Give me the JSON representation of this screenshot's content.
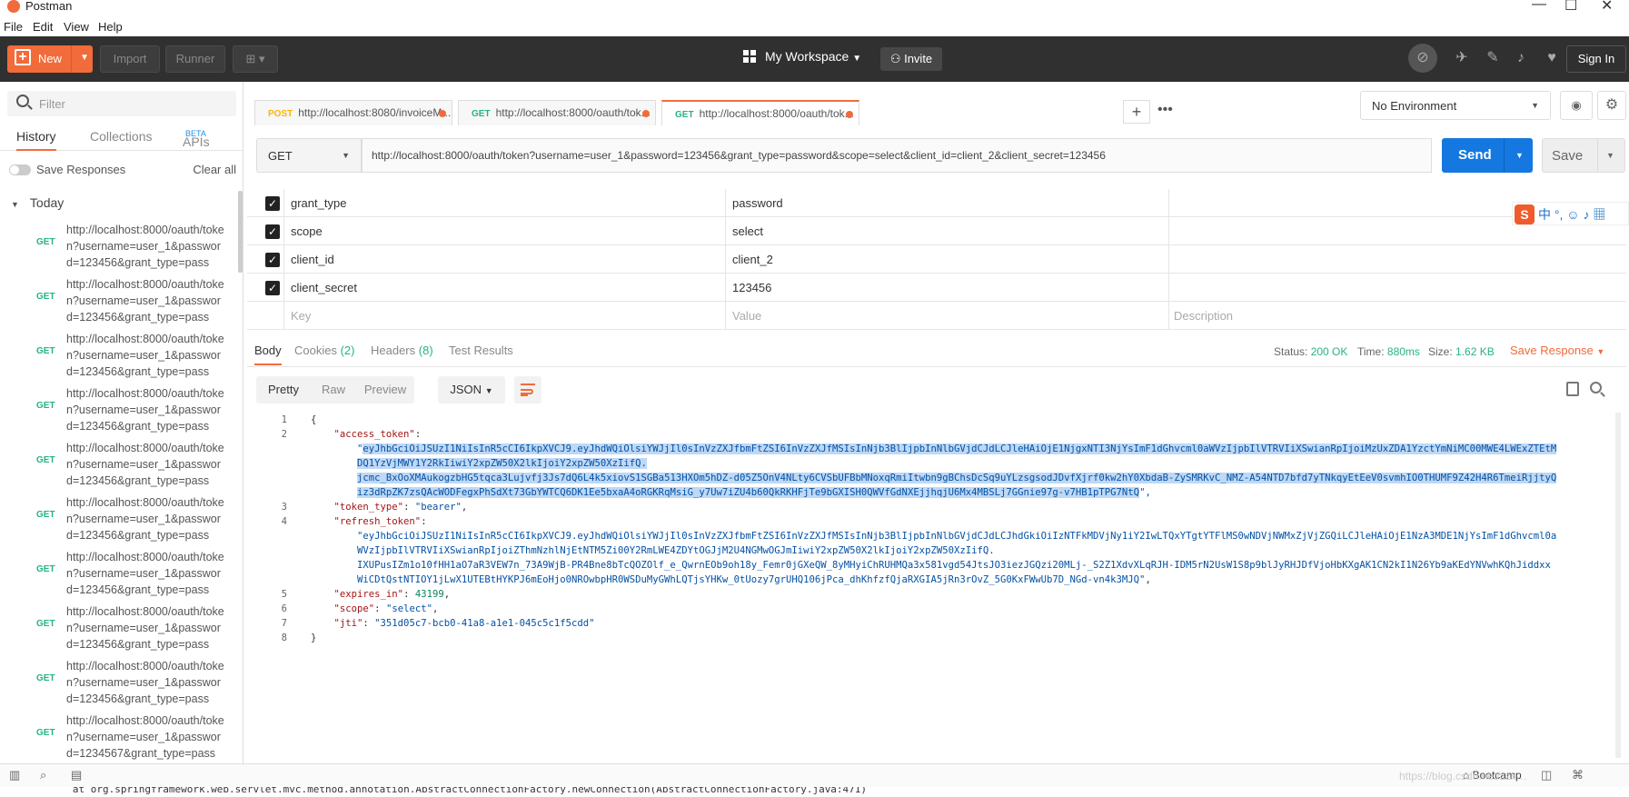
{
  "window": {
    "title": "Postman",
    "minimize": "—",
    "maximize": "☐",
    "close": "✕"
  },
  "menu": [
    "File",
    "Edit",
    "View",
    "Help"
  ],
  "header": {
    "new_label": "New",
    "import_label": "Import",
    "runner_label": "Runner",
    "workspace_label": "My Workspace",
    "invite_label": "Invite",
    "signin_label": "Sign In"
  },
  "sidebar": {
    "filter_placeholder": "Filter",
    "tabs": [
      "History",
      "Collections",
      "APIs"
    ],
    "apis_badge": "BETA",
    "save_responses": "Save Responses",
    "clear_all": "Clear all",
    "group": "Today",
    "items": [
      {
        "method": "GET",
        "url": "http://localhost:8000/oauth/token?username=user_1&password=123456&grant_type=pass"
      },
      {
        "method": "GET",
        "url": "http://localhost:8000/oauth/token?username=user_1&password=123456&grant_type=pass"
      },
      {
        "method": "GET",
        "url": "http://localhost:8000/oauth/token?username=user_1&password=123456&grant_type=pass"
      },
      {
        "method": "GET",
        "url": "http://localhost:8000/oauth/token?username=user_1&password=123456&grant_type=pass"
      },
      {
        "method": "GET",
        "url": "http://localhost:8000/oauth/token?username=user_1&password=123456&grant_type=pass"
      },
      {
        "method": "GET",
        "url": "http://localhost:8000/oauth/token?username=user_1&password=123456&grant_type=pass"
      },
      {
        "method": "GET",
        "url": "http://localhost:8000/oauth/token?username=user_1&password=123456&grant_type=pass"
      },
      {
        "method": "GET",
        "url": "http://localhost:8000/oauth/token?username=user_1&password=123456&grant_type=pass"
      },
      {
        "method": "GET",
        "url": "http://localhost:8000/oauth/token?username=user_1&password=123456&grant_type=pass"
      },
      {
        "method": "GET",
        "url": "http://localhost:8000/oauth/token?username=user_1&password=1234567&grant_type=pass"
      }
    ]
  },
  "tabs": [
    {
      "method": "POST",
      "label": "http://localhost:8080/invoiceM...",
      "color": "#ffb400"
    },
    {
      "method": "GET",
      "label": "http://localhost:8000/oauth/tok...",
      "color": "#26b47f"
    },
    {
      "method": "GET",
      "label": "http://localhost:8000/oauth/tok...",
      "color": "#26b47f"
    }
  ],
  "environment": {
    "selected": "No Environment"
  },
  "request": {
    "method": "GET",
    "url": "http://localhost:8000/oauth/token?username=user_1&password=123456&grant_type=password&scope=select&client_id=client_2&client_secret=123456",
    "send_label": "Send",
    "save_label": "Save"
  },
  "params": [
    {
      "key": "grant_type",
      "value": "password"
    },
    {
      "key": "scope",
      "value": "select"
    },
    {
      "key": "client_id",
      "value": "client_2"
    },
    {
      "key": "client_secret",
      "value": "123456"
    }
  ],
  "params_placeholder": {
    "key": "Key",
    "value": "Value",
    "description": "Description"
  },
  "ime": {
    "logo": "S",
    "text": "中 °, ☺ ♪ ▦"
  },
  "response": {
    "tabs": {
      "body": "Body",
      "cookies": "Cookies",
      "cookies_count": "(2)",
      "headers": "Headers",
      "headers_count": "(8)",
      "tests": "Test Results"
    },
    "status_label": "Status:",
    "status": "200 OK",
    "time_label": "Time:",
    "time": "880ms",
    "size_label": "Size:",
    "size": "1.62 KB",
    "save_response": "Save Response",
    "views": [
      "Pretty",
      "Raw",
      "Preview"
    ],
    "format": "JSON"
  },
  "code_lines": [
    {
      "n": "1",
      "parts": [
        {
          "t": "{",
          "c": ""
        }
      ]
    },
    {
      "n": "2",
      "parts": [
        {
          "t": "    \"access_token\"",
          "c": "key"
        },
        {
          "t": ":",
          "c": ""
        }
      ]
    },
    {
      "n": "",
      "parts": [
        {
          "t": "        \"",
          "c": "str"
        },
        {
          "t": "eyJhbGciOiJSUzI1NiIsInR5cCI6IkpXVCJ9.eyJhdWQiOlsiYWJjIl0sInVzZXJfbmFtZSI6InVzZXJfMSIsInNjb3BlIjpbInNlbGVjdCJdLCJleHAiOjE1NjgxNTI3NjYsImF1dGhvcml0aWVzIjpbIlVTRVIiXSwianRpIjoiMzUxZDA1YzctYmNiMC00MWE4LWExZTEtM",
          "c": "str sel"
        }
      ]
    },
    {
      "n": "",
      "parts": [
        {
          "t": "        ",
          "c": ""
        },
        {
          "t": "DQ1YzVjMWY1Y2RkIiwiY2xpZW50X2lkIjoiY2xpZW50XzIifQ.",
          "c": "str sel"
        }
      ]
    },
    {
      "n": "",
      "parts": [
        {
          "t": "        ",
          "c": ""
        },
        {
          "t": "jcmc_BxOoXMAukogzbHG5tqca3Lujvfj3Js7dQ6L4k5xiovS1SGBa513HXOm5hDZ-d05Z5OnV4NLty6CVSbUFBbMNoxqRmiItwbn9gBChsDcSq9uYLzsgsodJDvfXjrf0kw2hY0XbdaB-ZySMRKvC_NMZ-A54NTD7bfd7yTNkqyEtEeV0svmhIO0THUMF9Z42H4R6TmeiRjjtyQ",
          "c": "str sel"
        }
      ]
    },
    {
      "n": "",
      "parts": [
        {
          "t": "        ",
          "c": ""
        },
        {
          "t": "iz3dRpZK7zsQAcWODFegxPhSdXt73GbYWTCQ6DK1Ee5bxaA4oRGKRqMsiG_y7Uw7iZU4b60QkRKHFjTe9bGXISH0QWVfGdNXEjjhqjU6Mx4MBSLj7GGnie97g-v7HB1pTPG7NtQ",
          "c": "str sel"
        },
        {
          "t": "\",",
          "c": "str"
        }
      ]
    },
    {
      "n": "3",
      "parts": [
        {
          "t": "    \"token_type\"",
          "c": "key"
        },
        {
          "t": ": ",
          "c": ""
        },
        {
          "t": "\"bearer\"",
          "c": "str"
        },
        {
          "t": ",",
          "c": ""
        }
      ]
    },
    {
      "n": "4",
      "parts": [
        {
          "t": "    \"refresh_token\"",
          "c": "key"
        },
        {
          "t": ":",
          "c": ""
        }
      ]
    },
    {
      "n": "",
      "parts": [
        {
          "t": "        \"eyJhbGciOiJSUzI1NiIsInR5cCI6IkpXVCJ9.eyJhdWQiOlsiYWJjIl0sInVzZXJfbmFtZSI6InVzZXJfMSIsInNjb3BlIjpbInNlbGVjdCJdLCJhdGkiOiIzNTFkMDVjNy1iY2IwLTQxYTgtYTFlMS0wNDVjNWMxZjVjZGQiLCJleHAiOjE1NzA3MDE1NjYsImF1dGhvcml0a",
          "c": "str"
        }
      ]
    },
    {
      "n": "",
      "parts": [
        {
          "t": "        WVzIjpbIlVTRVIiXSwianRpIjoiZThmNzhlNjEtNTM5Zi00Y2RmLWE4ZDYtOGJjM2U4NGMwOGJmIiwiY2xpZW50X2lkIjoiY2xpZW50XzIifQ.",
          "c": "str"
        }
      ]
    },
    {
      "n": "",
      "parts": [
        {
          "t": "        IXUPusIZm1o10fHH1aO7aR3VEW7n_73A9WjB-PR4Bne8bTcQOZOlf_e_QwrnEOb9oh18y_Femr0jGXeQW_8yMHyiChRUHMQa3x581vgd54JtsJO3iezJGQzi20MLj-_S2Z1XdvXLqRJH-IDM5rN2UsW1S8p9blJyRHJDfVjoHbKXgAK1CN2kI1N26Yb9aKEdYNVwhKQhJiddxx",
          "c": "str"
        }
      ]
    },
    {
      "n": "",
      "parts": [
        {
          "t": "        WiCDtQstNTIOY1jLwX1UTEBtHYKPJ6mEoHjo0NROwbpHR0WSDuMyGWhLQTjsYHKw_0tUozy7grUHQ106jPca_dhKhfzfQjaRXGIA5jRn3rOvZ_5G0KxFWwUb7D_NGd-vn4k3MJQ\"",
          "c": "str"
        },
        {
          "t": ",",
          "c": ""
        }
      ]
    },
    {
      "n": "5",
      "parts": [
        {
          "t": "    \"expires_in\"",
          "c": "key"
        },
        {
          "t": ": ",
          "c": ""
        },
        {
          "t": "43199",
          "c": "num"
        },
        {
          "t": ",",
          "c": ""
        }
      ]
    },
    {
      "n": "6",
      "parts": [
        {
          "t": "    \"scope\"",
          "c": "key"
        },
        {
          "t": ": ",
          "c": ""
        },
        {
          "t": "\"select\"",
          "c": "str"
        },
        {
          "t": ",",
          "c": ""
        }
      ]
    },
    {
      "n": "7",
      "parts": [
        {
          "t": "    \"jti\"",
          "c": "key"
        },
        {
          "t": ": ",
          "c": ""
        },
        {
          "t": "\"351d05c7-bcb0-41a8-a1e1-045c5c1f5cdd\"",
          "c": "str"
        }
      ]
    },
    {
      "n": "8",
      "parts": [
        {
          "t": "}",
          "c": ""
        }
      ]
    }
  ],
  "statusbar": {
    "bootcamp": "Bootcamp",
    "watermark": "https://blog.csdn.net/zzx…"
  },
  "bottom_text": "   at org.springframework.web.servlet.mvc.method.annotation.AbstractConnectionFactory.newConnection(AbstractConnectionFactory.java:471)"
}
